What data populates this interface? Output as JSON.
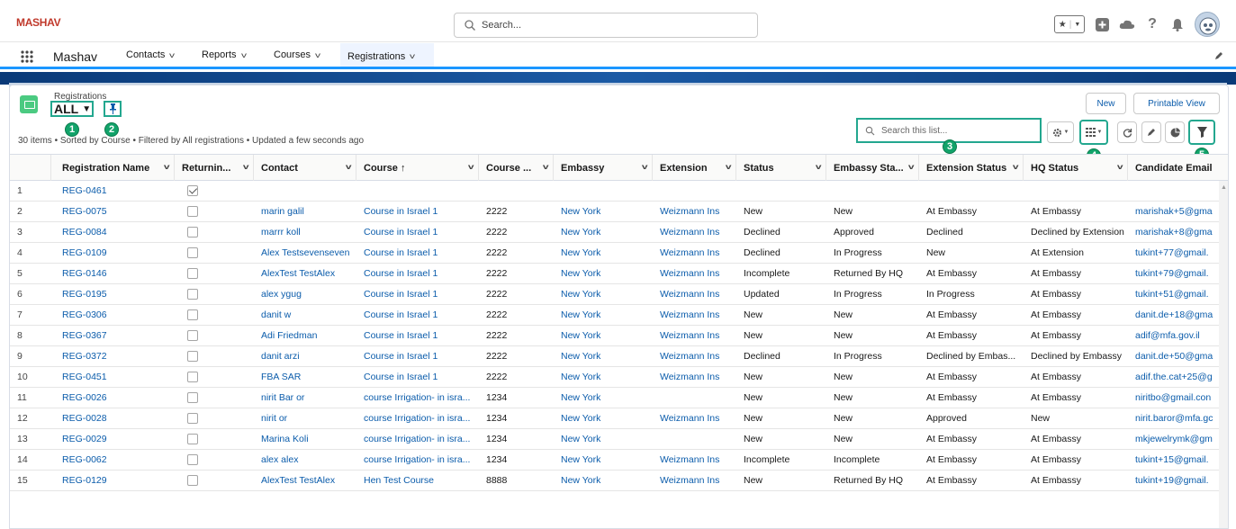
{
  "header": {
    "logo_text": "MASHAV",
    "logo_sub": "",
    "search_placeholder": "Search..."
  },
  "nav": {
    "app_name": "Mashav",
    "tabs": [
      {
        "label": "Contacts"
      },
      {
        "label": "Reports"
      },
      {
        "label": "Courses"
      },
      {
        "label": "Registrations"
      }
    ]
  },
  "list": {
    "object_label": "Registrations",
    "view_name": "ALL",
    "summary": "30 items • Sorted by Course • Filtered by All registrations • Updated a few seconds ago",
    "new_label": "New",
    "printable_label": "Printable View",
    "search_placeholder": "Search this list...",
    "badges": [
      "1",
      "2",
      "3",
      "4",
      "5"
    ]
  },
  "columns": [
    "Registration Name",
    "Returnin...",
    "Contact",
    "Course ↑",
    "Course ...",
    "Embassy",
    "Extension",
    "Status",
    "Embassy Sta...",
    "Extension Status",
    "HQ Status",
    "Candidate Email"
  ],
  "rows": [
    {
      "n": "1",
      "name": "REG-0461",
      "ret": true,
      "contact": "",
      "course": "",
      "code": "",
      "embassy": "",
      "ext": "",
      "status": "",
      "emb_status": "",
      "ext_status": "",
      "hq": "",
      "email": ""
    },
    {
      "n": "2",
      "name": "REG-0075",
      "ret": false,
      "contact": "marin galil",
      "course": "Course in Israel 1",
      "code": "2222",
      "embassy": "New York",
      "ext": "Weizmann Ins",
      "status": "New",
      "emb_status": "New",
      "ext_status": "At Embassy",
      "hq": "At Embassy",
      "email": "marishak+5@gma"
    },
    {
      "n": "3",
      "name": "REG-0084",
      "ret": false,
      "contact": "marrr koll",
      "course": "Course in Israel 1",
      "code": "2222",
      "embassy": "New York",
      "ext": "Weizmann Ins",
      "status": "Declined",
      "emb_status": "Approved",
      "ext_status": "Declined",
      "hq": "Declined by Extension",
      "email": "marishak+8@gma"
    },
    {
      "n": "4",
      "name": "REG-0109",
      "ret": false,
      "contact": "Alex Testsevenseven",
      "course": "Course in Israel 1",
      "code": "2222",
      "embassy": "New York",
      "ext": "Weizmann Ins",
      "status": "Declined",
      "emb_status": "In Progress",
      "ext_status": "New",
      "hq": "At Extension",
      "email": "tukint+77@gmail."
    },
    {
      "n": "5",
      "name": "REG-0146",
      "ret": false,
      "contact": "AlexTest TestAlex",
      "course": "Course in Israel 1",
      "code": "2222",
      "embassy": "New York",
      "ext": "Weizmann Ins",
      "status": "Incomplete",
      "emb_status": "Returned By HQ",
      "ext_status": "At Embassy",
      "hq": "At Embassy",
      "email": "tukint+79@gmail."
    },
    {
      "n": "6",
      "name": "REG-0195",
      "ret": false,
      "contact": "alex ygug",
      "course": "Course in Israel 1",
      "code": "2222",
      "embassy": "New York",
      "ext": "Weizmann Ins",
      "status": "Updated",
      "emb_status": "In Progress",
      "ext_status": "In Progress",
      "hq": "At Embassy",
      "email": "tukint+51@gmail."
    },
    {
      "n": "7",
      "name": "REG-0306",
      "ret": false,
      "contact": "danit w",
      "course": "Course in Israel 1",
      "code": "2222",
      "embassy": "New York",
      "ext": "Weizmann Ins",
      "status": "New",
      "emb_status": "New",
      "ext_status": "At Embassy",
      "hq": "At Embassy",
      "email": "danit.de+18@gma"
    },
    {
      "n": "8",
      "name": "REG-0367",
      "ret": false,
      "contact": "Adi Friedman",
      "course": "Course in Israel 1",
      "code": "2222",
      "embassy": "New York",
      "ext": "Weizmann Ins",
      "status": "New",
      "emb_status": "New",
      "ext_status": "At Embassy",
      "hq": "At Embassy",
      "email": "adif@mfa.gov.il"
    },
    {
      "n": "9",
      "name": "REG-0372",
      "ret": false,
      "contact": "danit arzi",
      "course": "Course in Israel 1",
      "code": "2222",
      "embassy": "New York",
      "ext": "Weizmann Ins",
      "status": "Declined",
      "emb_status": "In Progress",
      "ext_status": "Declined by Embas...",
      "hq": "Declined by Embassy",
      "email": "danit.de+50@gma"
    },
    {
      "n": "10",
      "name": "REG-0451",
      "ret": false,
      "contact": "FBA SAR",
      "course": "Course in Israel 1",
      "code": "2222",
      "embassy": "New York",
      "ext": "Weizmann Ins",
      "status": "New",
      "emb_status": "New",
      "ext_status": "At Embassy",
      "hq": "At Embassy",
      "email": "adif.the.cat+25@g"
    },
    {
      "n": "11",
      "name": "REG-0026",
      "ret": false,
      "contact": "nirit Bar or",
      "course": "course Irrigation- in isra...",
      "code": "1234",
      "embassy": "New York",
      "ext": "",
      "status": "New",
      "emb_status": "New",
      "ext_status": "At Embassy",
      "hq": "At Embassy",
      "email": "niritbo@gmail.con"
    },
    {
      "n": "12",
      "name": "REG-0028",
      "ret": false,
      "contact": "nirit or",
      "course": "course Irrigation- in isra...",
      "code": "1234",
      "embassy": "New York",
      "ext": "Weizmann Ins",
      "status": "New",
      "emb_status": "New",
      "ext_status": "Approved",
      "hq": "New",
      "email": "nirit.baror@mfa.gc"
    },
    {
      "n": "13",
      "name": "REG-0029",
      "ret": false,
      "contact": "Marina Koli",
      "course": "course Irrigation- in isra...",
      "code": "1234",
      "embassy": "New York",
      "ext": "",
      "status": "New",
      "emb_status": "New",
      "ext_status": "At Embassy",
      "hq": "At Embassy",
      "email": "mkjewelrymk@gm"
    },
    {
      "n": "14",
      "name": "REG-0062",
      "ret": false,
      "contact": "alex alex",
      "course": "course Irrigation- in isra...",
      "code": "1234",
      "embassy": "New York",
      "ext": "Weizmann Ins",
      "status": "Incomplete",
      "emb_status": "Incomplete",
      "ext_status": "At Embassy",
      "hq": "At Embassy",
      "email": "tukint+15@gmail."
    },
    {
      "n": "15",
      "name": "REG-0129",
      "ret": false,
      "contact": "AlexTest TestAlex",
      "course": "Hen Test Course",
      "code": "8888",
      "embassy": "New York",
      "ext": "Weizmann Ins",
      "status": "New",
      "emb_status": "Returned By HQ",
      "ext_status": "At Embassy",
      "hq": "At Embassy",
      "email": "tukint+19@gmail."
    }
  ],
  "colors": {
    "link": "#0b5cab",
    "highlight": "#23a78f",
    "badge": "#12a36a",
    "nav_active": "#1b96ff"
  }
}
